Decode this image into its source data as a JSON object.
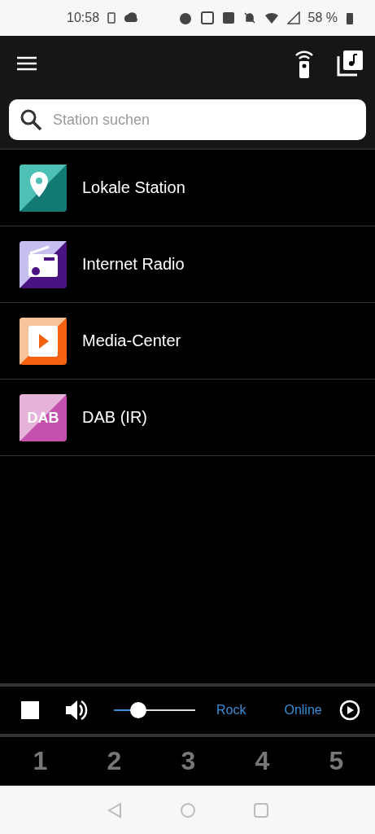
{
  "status_bar": {
    "time": "10:58",
    "battery_text": "58 %"
  },
  "search": {
    "placeholder": "Station suchen"
  },
  "items": [
    {
      "kind": "location",
      "label": "Lokale Station"
    },
    {
      "kind": "radio",
      "label": "Internet Radio"
    },
    {
      "kind": "media",
      "label": "Media-Center"
    },
    {
      "kind": "dab",
      "label": "DAB (IR)",
      "icon_text": "DAB"
    }
  ],
  "player": {
    "volume": {
      "level": 0.3
    },
    "texts": [
      "Rock",
      "Online"
    ]
  },
  "presets": [
    "1",
    "2",
    "3",
    "4",
    "5"
  ]
}
